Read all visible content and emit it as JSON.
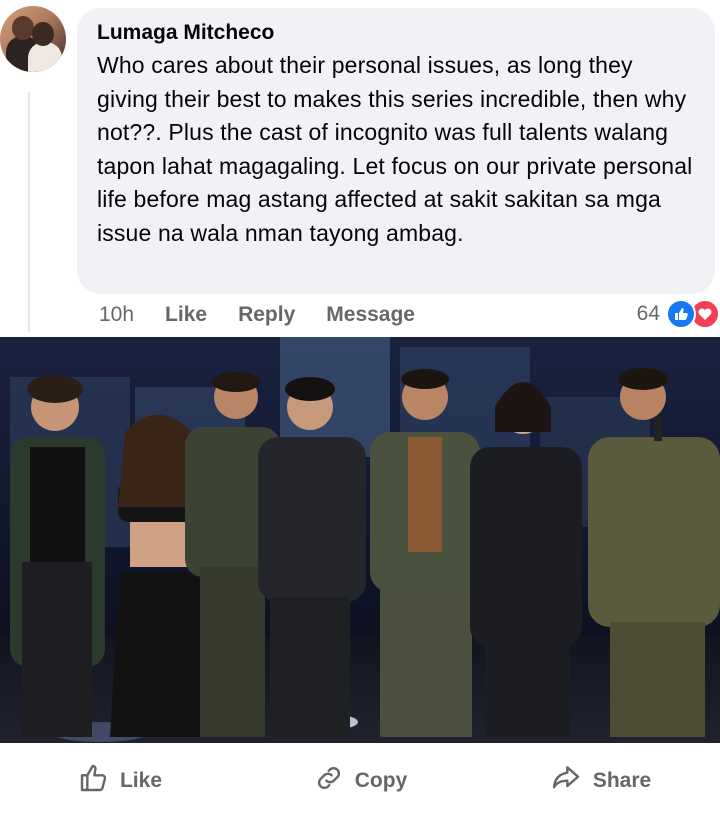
{
  "comment": {
    "author": "Lumaga Mitcheco",
    "text": "Who cares about their personal issues, as long they giving their best to makes this series incredible, then why not??. Plus the cast of incognito was full talents walang tapon lahat magagaling. Let focus on our private personal life before mag astang affected at sakit sakitan sa mga issue na wala nman tayong ambag.",
    "time": "10h",
    "actions": [
      "Like",
      "Reply",
      "Message"
    ],
    "reaction_count": "64",
    "reactions": [
      "like-icon",
      "love-icon"
    ]
  },
  "footer": {
    "like_label": "Like",
    "copy_label": "Copy",
    "share_label": "Share"
  },
  "colors": {
    "bubble": "#f0f2f5",
    "secondary_text": "#65676b",
    "like_blue": "#1877f2",
    "love_red": "#f33e58"
  }
}
